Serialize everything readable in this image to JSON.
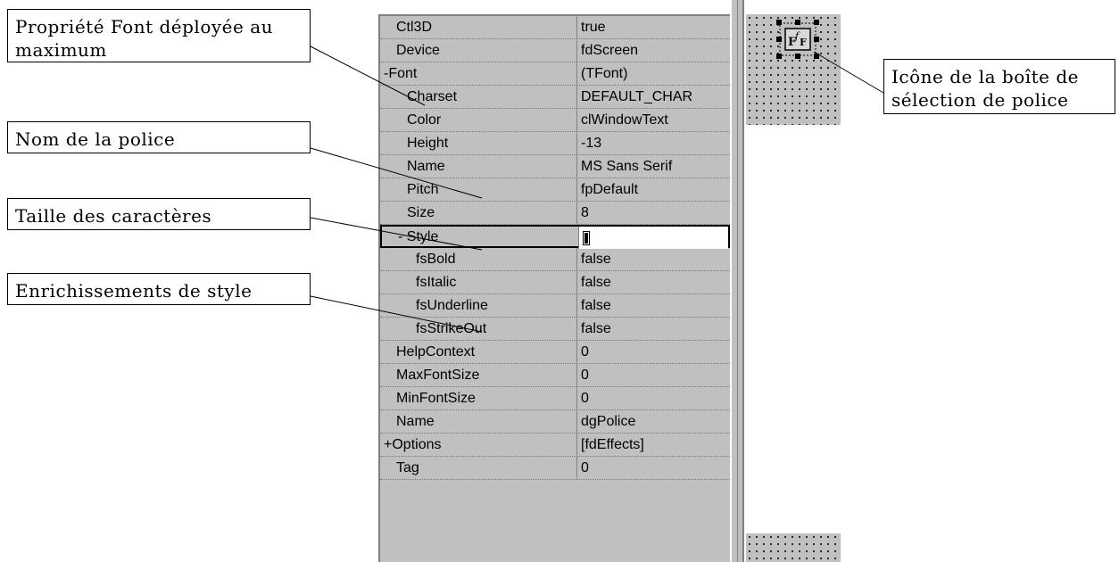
{
  "callouts": {
    "font_expanded": "Propriété Font déployée au maximum",
    "font_name": "Nom de la police",
    "char_size": "Taille des caractères",
    "style": "Enrichissements de style",
    "icon": "Icône de la boîte de sélection de police"
  },
  "properties": [
    {
      "name": "Ctl3D",
      "value": "true",
      "indent": 1
    },
    {
      "name": "Device",
      "value": "fdScreen",
      "indent": 1
    },
    {
      "name": "-Font",
      "value": "(TFont)",
      "indent": 0
    },
    {
      "name": "Charset",
      "value": "DEFAULT_CHAR",
      "indent": 2
    },
    {
      "name": "Color",
      "value": "clWindowText",
      "indent": 2
    },
    {
      "name": "Height",
      "value": "-13",
      "indent": 2
    },
    {
      "name": "Name",
      "value": "MS Sans Serif",
      "indent": 2
    },
    {
      "name": "Pitch",
      "value": "fpDefault",
      "indent": 2
    },
    {
      "name": "Size",
      "value": "8",
      "indent": 2
    },
    {
      "name": "- Style",
      "value": "",
      "indent": 1,
      "selected": true
    },
    {
      "name": "fsBold",
      "value": "false",
      "indent": 3
    },
    {
      "name": "fsItalic",
      "value": "false",
      "indent": 3
    },
    {
      "name": "fsUnderline",
      "value": "false",
      "indent": 3
    },
    {
      "name": "fsStrikeOut",
      "value": "false",
      "indent": 3
    },
    {
      "name": "HelpContext",
      "value": "0",
      "indent": 1
    },
    {
      "name": "MaxFontSize",
      "value": "0",
      "indent": 1
    },
    {
      "name": "MinFontSize",
      "value": "0",
      "indent": 1
    },
    {
      "name": "Name",
      "value": "dgPolice",
      "indent": 1
    },
    {
      "name": "+Options",
      "value": "[fdEffects]",
      "indent": 0
    },
    {
      "name": "Tag",
      "value": "0",
      "indent": 1
    }
  ],
  "icon_name": "font-dialog-icon",
  "colors": {
    "panel": "#c0c0c0",
    "lines": "#000000"
  }
}
